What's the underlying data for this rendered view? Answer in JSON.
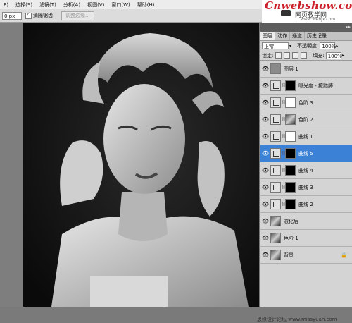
{
  "menubar": {
    "items": [
      "E)",
      "选择(S)",
      "滤镜(T)",
      "分析(A)",
      "视图(V)",
      "窗口(W)",
      "帮助(H)"
    ]
  },
  "options": {
    "feather_value": "0 px",
    "anti_alias_label": "消除锯齿",
    "refine_edge_label": "调整边缘..."
  },
  "brand": {
    "name": "Cnwebshow.com",
    "sub": "网页教学网",
    "url": "www.Webjx.com"
  },
  "panel": {
    "tabs": [
      "图层",
      "动作",
      "通道",
      "历史记录"
    ],
    "blend_mode": "正常",
    "opacity_label": "不透明度:",
    "opacity_value": "100%",
    "lock_label": "锁定:",
    "fill_label": "填充:",
    "fill_value": "100%",
    "layers": [
      {
        "name": "图层 1",
        "thumb": "gray",
        "mask": "",
        "selected": false
      },
      {
        "name": "曝光度 - 撩黯膊",
        "thumb": "adj",
        "mask": "black",
        "selected": false
      },
      {
        "name": "色阶 3",
        "thumb": "adj",
        "mask": "white",
        "selected": false
      },
      {
        "name": "色阶 2",
        "thumb": "adj",
        "mask": "photo",
        "selected": false
      },
      {
        "name": "曲线 1",
        "thumb": "adj",
        "mask": "white",
        "selected": false
      },
      {
        "name": "曲线 5",
        "thumb": "adj",
        "mask": "black",
        "selected": true
      },
      {
        "name": "曲线 4",
        "thumb": "adj",
        "mask": "black",
        "selected": false
      },
      {
        "name": "曲线 3",
        "thumb": "adj",
        "mask": "black",
        "selected": false
      },
      {
        "name": "曲线 2",
        "thumb": "adj",
        "mask": "black",
        "selected": false
      },
      {
        "name": "液化后",
        "thumb": "photo",
        "mask": "",
        "selected": false
      },
      {
        "name": "色阶 1",
        "thumb": "photo",
        "mask": "",
        "selected": false
      },
      {
        "name": "背景",
        "thumb": "photo",
        "mask": "",
        "selected": false
      }
    ]
  },
  "watermark": "思缘设计论坛 www.missyuan.com"
}
